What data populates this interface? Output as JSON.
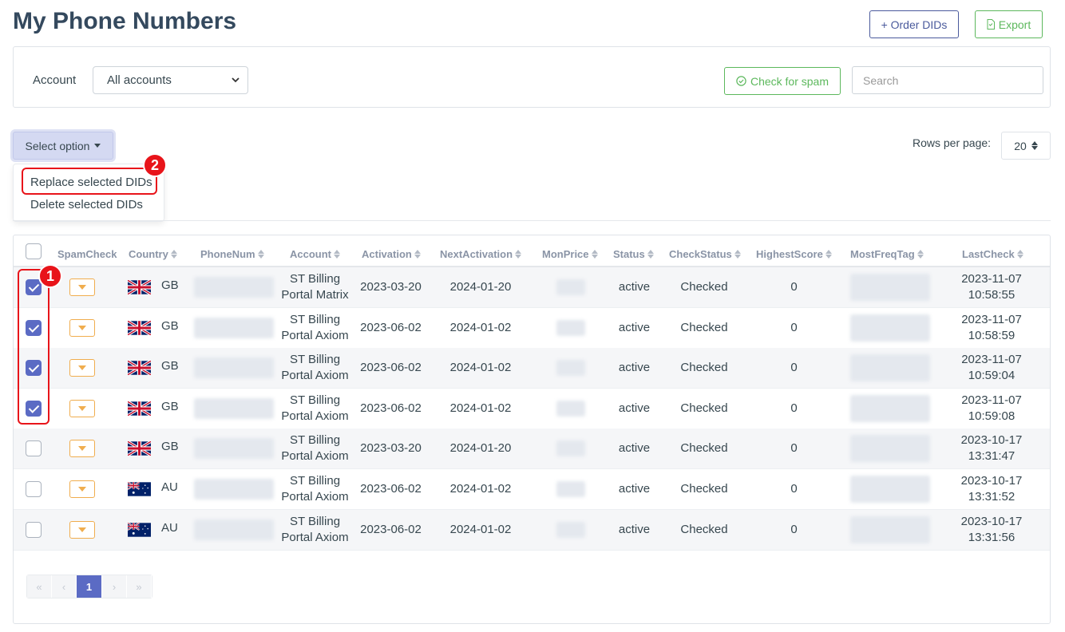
{
  "page": {
    "title": "My Phone Numbers"
  },
  "header": {
    "order_label": "+ Order DIDs",
    "export_label": "Export"
  },
  "filters": {
    "account_label": "Account",
    "account_value": "All accounts",
    "check_spam_label": "Check for spam",
    "search_placeholder": "Search"
  },
  "bulk": {
    "select_option_label": "Select option",
    "menu": [
      "Replace selected DIDs",
      "Delete selected DIDs"
    ]
  },
  "pagination_controls": {
    "rows_label": "Rows per page:",
    "rows_value": "20"
  },
  "annotations": {
    "badge1": "1",
    "badge2": "2"
  },
  "table": {
    "columns": [
      "SpamCheck",
      "Country",
      "PhoneNum",
      "Account",
      "Activation",
      "NextActivation",
      "MonPrice",
      "Status",
      "CheckStatus",
      "HighestScore",
      "MostFreqTag",
      "LastCheck"
    ],
    "rows": [
      {
        "checked": true,
        "country": "GB",
        "account1": "ST Billing",
        "account2": "Portal Matrix",
        "activation": "2023-03-20",
        "next": "2024-01-20",
        "status": "active",
        "checkstatus": "Checked",
        "score": "0",
        "date": "2023-11-07",
        "time": "10:58:55"
      },
      {
        "checked": true,
        "country": "GB",
        "account1": "ST Billing",
        "account2": "Portal Axiom",
        "activation": "2023-06-02",
        "next": "2024-01-02",
        "status": "active",
        "checkstatus": "Checked",
        "score": "0",
        "date": "2023-11-07",
        "time": "10:58:59"
      },
      {
        "checked": true,
        "country": "GB",
        "account1": "ST Billing",
        "account2": "Portal Axiom",
        "activation": "2023-06-02",
        "next": "2024-01-02",
        "status": "active",
        "checkstatus": "Checked",
        "score": "0",
        "date": "2023-11-07",
        "time": "10:59:04"
      },
      {
        "checked": true,
        "country": "GB",
        "account1": "ST Billing",
        "account2": "Portal Axiom",
        "activation": "2023-06-02",
        "next": "2024-01-02",
        "status": "active",
        "checkstatus": "Checked",
        "score": "0",
        "date": "2023-11-07",
        "time": "10:59:08"
      },
      {
        "checked": false,
        "country": "GB",
        "account1": "ST Billing",
        "account2": "Portal Axiom",
        "activation": "2023-03-20",
        "next": "2024-01-20",
        "status": "active",
        "checkstatus": "Checked",
        "score": "0",
        "date": "2023-10-17",
        "time": "13:31:47"
      },
      {
        "checked": false,
        "country": "AU",
        "account1": "ST Billing",
        "account2": "Portal Axiom",
        "activation": "2023-06-02",
        "next": "2024-01-02",
        "status": "active",
        "checkstatus": "Checked",
        "score": "0",
        "date": "2023-10-17",
        "time": "13:31:52"
      },
      {
        "checked": false,
        "country": "AU",
        "account1": "ST Billing",
        "account2": "Portal Axiom",
        "activation": "2023-06-02",
        "next": "2024-01-02",
        "status": "active",
        "checkstatus": "Checked",
        "score": "0",
        "date": "2023-10-17",
        "time": "13:31:56"
      }
    ]
  },
  "pagination": {
    "first": "«",
    "prev": "‹",
    "current": "1",
    "next": "›",
    "last": "»"
  },
  "colors": {
    "primary": "#5b6bc4",
    "success": "#5cb85c",
    "warning": "#f0ad4e",
    "highlight": "#e8141a"
  }
}
